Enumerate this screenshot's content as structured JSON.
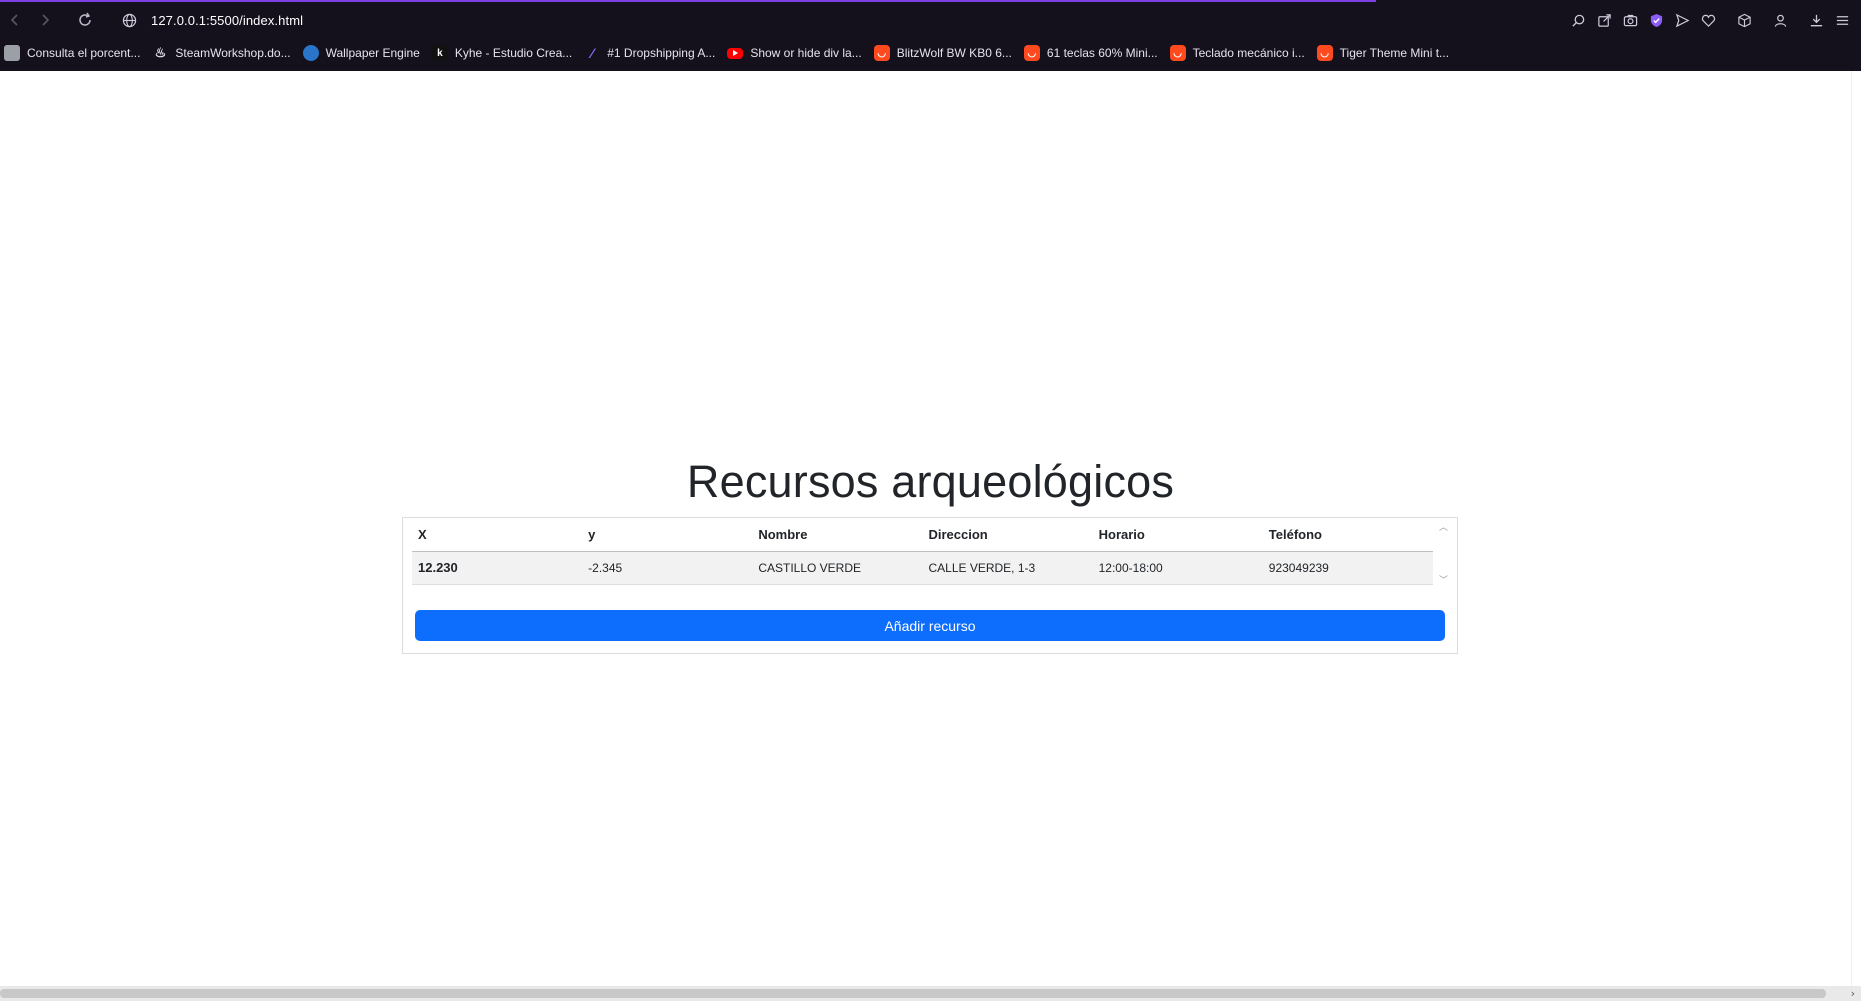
{
  "browser": {
    "url": "127.0.0.1:5500/index.html",
    "bookmarks": [
      {
        "label": "Consulta el porcent...",
        "icon": "generic-favicon"
      },
      {
        "label": "SteamWorkshop.do...",
        "icon": "steam-icon"
      },
      {
        "label": "Wallpaper Engine",
        "icon": "wallpaper-engine-icon"
      },
      {
        "label": "Kyhe - Estudio Crea...",
        "icon": "kyhe-icon"
      },
      {
        "label": "#1 Dropshipping A...",
        "icon": "dropshipping-icon"
      },
      {
        "label": "Show or hide div la...",
        "icon": "youtube-icon"
      },
      {
        "label": "BlitzWolf BW KB0 6...",
        "icon": "aliexpress-icon"
      },
      {
        "label": "61 teclas 60% Mini...",
        "icon": "aliexpress-icon"
      },
      {
        "label": "Teclado mecánico i...",
        "icon": "aliexpress-icon"
      },
      {
        "label": "Tiger Theme Mini t...",
        "icon": "aliexpress-icon"
      }
    ],
    "accent_color": "#7b3fe4"
  },
  "page": {
    "title": "Recursos arqueológicos",
    "table": {
      "headers": [
        "X",
        "y",
        "Nombre",
        "Direccion",
        "Horario",
        "Teléfono"
      ],
      "rows": [
        [
          "12.230",
          "-2.345",
          "CASTILLO VERDE",
          "CALLE VERDE, 1-3",
          "12:00-18:00",
          "923049239"
        ]
      ]
    },
    "add_button_label": "Añadir recurso",
    "button_color": "#0d6efd"
  }
}
